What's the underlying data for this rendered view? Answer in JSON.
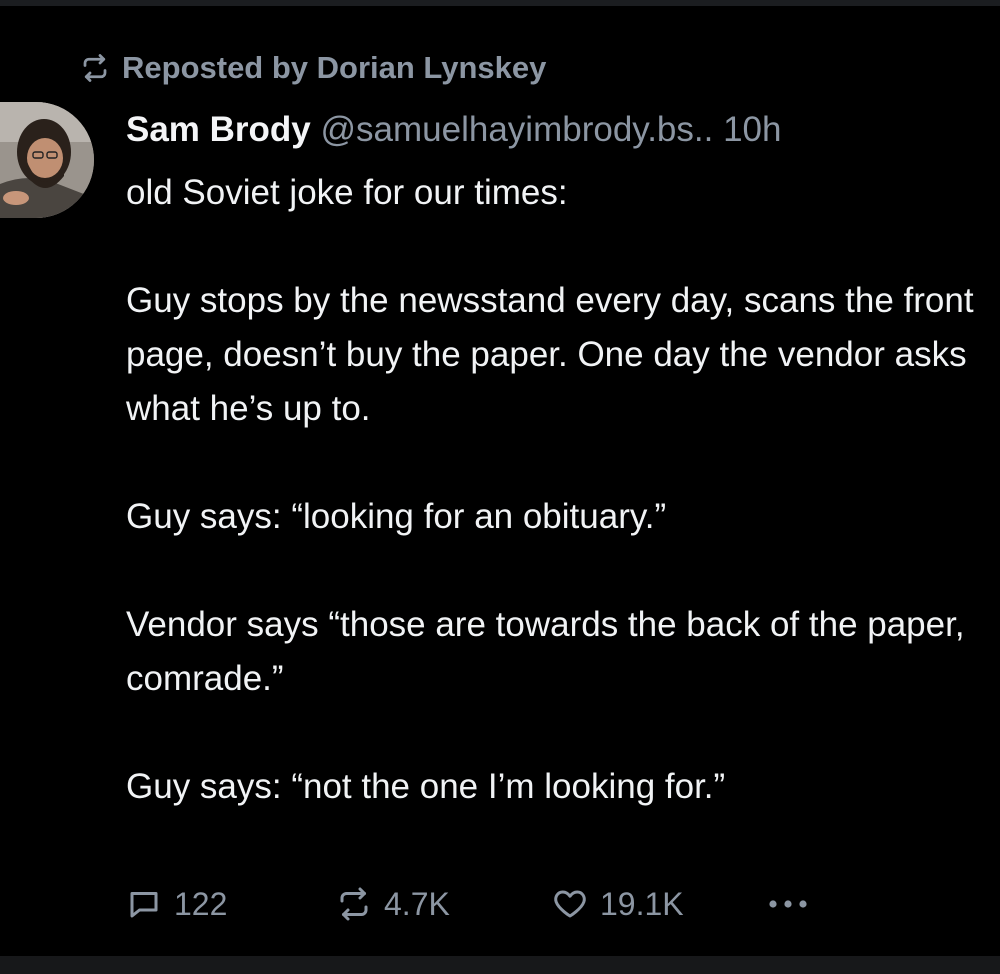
{
  "colors": {
    "background": "#000000",
    "text_primary": "#f1f3f5",
    "text_secondary": "#8c96a3"
  },
  "repost": {
    "icon": "repost-icon",
    "text": "Reposted by Dorian Lynskey"
  },
  "post": {
    "avatar": "author-avatar",
    "author_name": "Sam Brody",
    "author_handle": "@samuelhayimbrody.bs..",
    "time": "10h",
    "paragraphs": [
      "old Soviet joke for our times:",
      "Guy stops by the newsstand every day, scans the front page, doesn’t buy the paper. One day the vendor asks what he’s up to.",
      "Guy says: “looking for an obituary.”",
      "Vendor says “those are towards the back of the paper, comrade.”",
      "Guy says: “not the one I’m looking for.”"
    ]
  },
  "actions": {
    "reply": {
      "icon": "reply-icon",
      "count": "122"
    },
    "repost": {
      "icon": "repost-icon",
      "count": "4.7K"
    },
    "like": {
      "icon": "heart-icon",
      "count": "19.1K"
    },
    "more": {
      "icon": "more-options-icon"
    }
  }
}
